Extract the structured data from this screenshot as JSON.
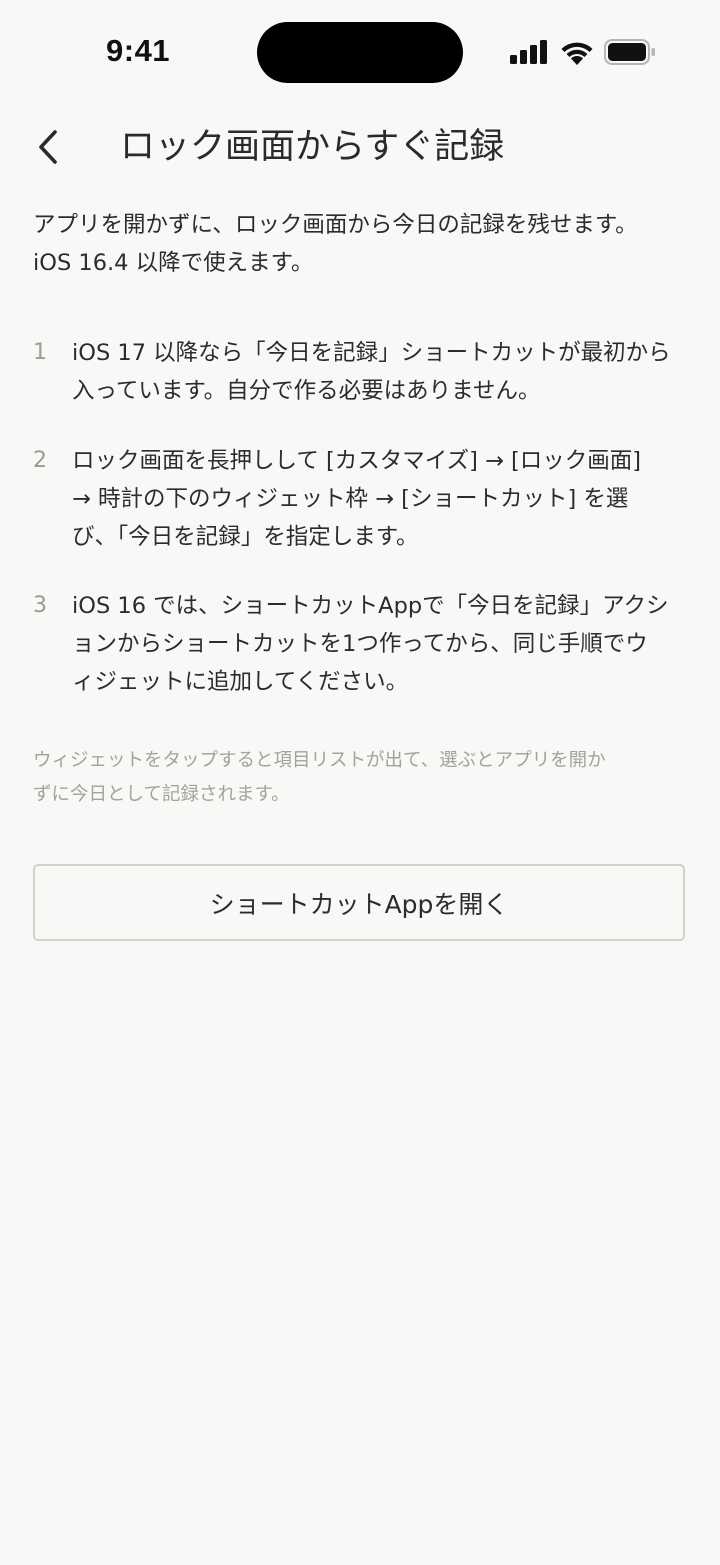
{
  "status_bar": {
    "time": "9:41",
    "icons": [
      "cellular-signal-icon",
      "wifi-icon",
      "battery-icon"
    ]
  },
  "nav": {
    "back_icon": "chevron-left-icon",
    "title": "ロック画面からすぐ記録"
  },
  "intro": {
    "line1": "アプリを開かずに、ロック画面から今日の記録を残せます。",
    "line2": "iOS 16.4 以降で使えます。"
  },
  "steps": [
    {
      "number": "1",
      "lines": [
        "iOS 17 以降なら「今日を記録」ショートカットが最初から",
        "入っています。自分で作る必要はありません。"
      ]
    },
    {
      "number": "2",
      "lines": [
        "ロック画面を長押しして [カスタマイズ] → [ロック画面]",
        "→ 時計の下のウィジェット枠 → [ショートカット] を選",
        "び、「今日を記録」を指定します。"
      ]
    },
    {
      "number": "3",
      "lines": [
        "iOS 16 では、ショートカットAppで「今日を記録」アクシ",
        "ョンからショートカットを1つ作ってから、同じ手順でウ",
        "ィジェットに追加してください。"
      ]
    }
  ],
  "note": {
    "line1": "ウィジェットをタップすると項目リストが出て、選ぶとアプリを開か",
    "line2": "ずに今日として記録されます。"
  },
  "button": {
    "label": "ショートカットAppを開く"
  },
  "colors": {
    "background": "#f9f8f6",
    "text": "#2c2c2c",
    "muted": "#a3a29e",
    "border": "#d2d1cd"
  }
}
